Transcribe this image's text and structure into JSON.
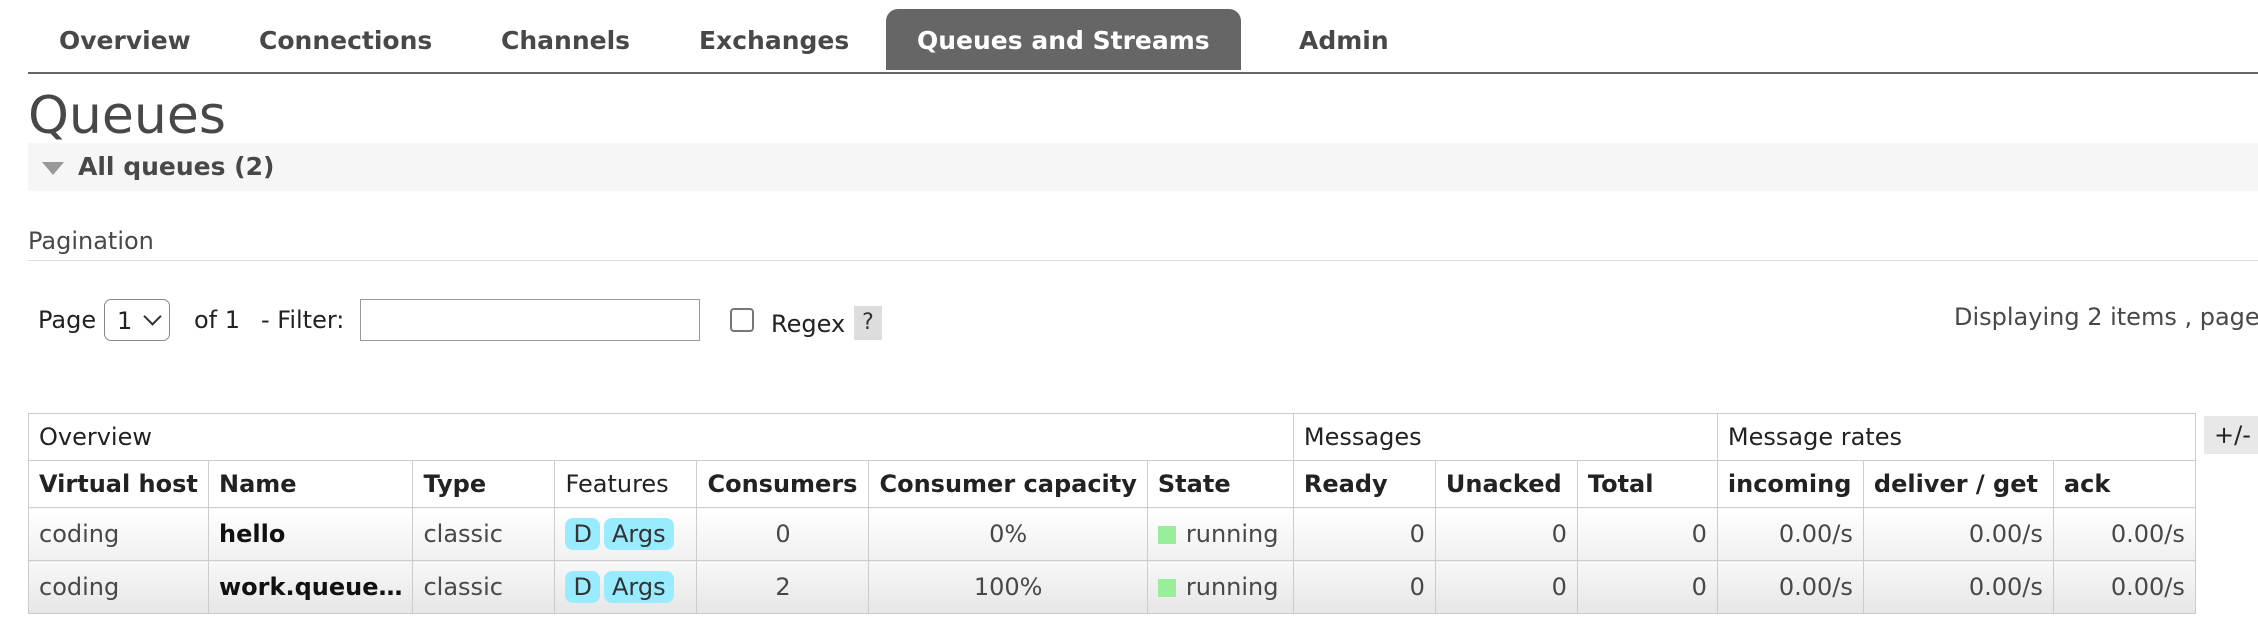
{
  "nav": {
    "tabs": [
      {
        "label": "Overview"
      },
      {
        "label": "Connections"
      },
      {
        "label": "Channels"
      },
      {
        "label": "Exchanges"
      },
      {
        "label": "Queues and Streams",
        "active": true
      },
      {
        "label": "Admin"
      }
    ]
  },
  "page": {
    "title": "Queues"
  },
  "section": {
    "label": "All queues (2)"
  },
  "pagination": {
    "heading": "Pagination",
    "page_label": "Page",
    "page_value": "1",
    "of_label": "of 1",
    "filter_label": "- Filter:",
    "filter_value": "",
    "regex_label": "Regex",
    "regex_checked": false,
    "help_label": "?",
    "display_text": "Displaying 2 items , page"
  },
  "table": {
    "groups": [
      "Overview",
      "Messages",
      "Message rates"
    ],
    "toggle_label": "+/-",
    "columns": [
      "Virtual host",
      "Name",
      "Type",
      "Features",
      "Consumers",
      "Consumer capacity",
      "State",
      "Ready",
      "Unacked",
      "Total",
      "incoming",
      "deliver / get",
      "ack"
    ],
    "rows": [
      {
        "vhost": "coding",
        "name": "hello",
        "type": "classic",
        "features": [
          "D",
          "Args"
        ],
        "consumers": "0",
        "capacity": "0%",
        "state": "running",
        "ready": "0",
        "unacked": "0",
        "total": "0",
        "incoming": "0.00/s",
        "deliver": "0.00/s",
        "ack": "0.00/s"
      },
      {
        "vhost": "coding",
        "name": "work.queue…",
        "type": "classic",
        "features": [
          "D",
          "Args"
        ],
        "consumers": "2",
        "capacity": "100%",
        "state": "running",
        "ready": "0",
        "unacked": "0",
        "total": "0",
        "incoming": "0.00/s",
        "deliver": "0.00/s",
        "ack": "0.00/s"
      }
    ]
  },
  "colors": {
    "active_tab_bg": "#666666",
    "feature_badge": "#99ebff",
    "state_running": "#99ee99"
  }
}
